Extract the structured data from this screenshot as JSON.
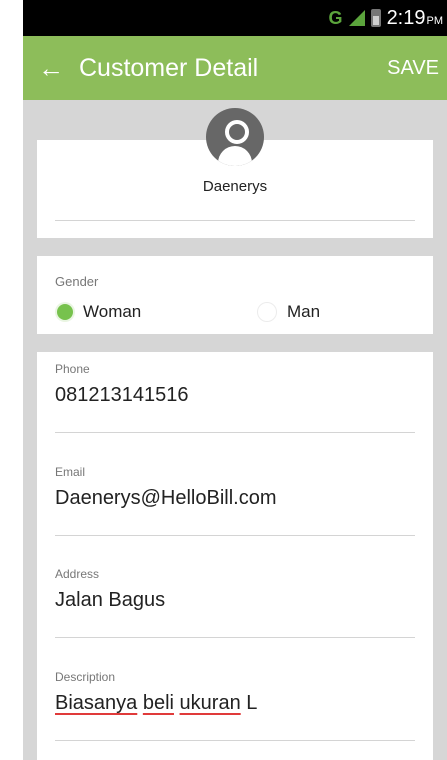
{
  "status_bar": {
    "network": "G",
    "time": "2:19",
    "ampm": "PM"
  },
  "app_bar": {
    "back_icon": "arrow-left-icon",
    "title": "Customer Detail",
    "save_label": "SAVE"
  },
  "profile": {
    "avatar_icon": "person-icon",
    "name": "Daenerys"
  },
  "gender": {
    "label": "Gender",
    "options": [
      {
        "label": "Woman",
        "selected": true
      },
      {
        "label": "Man",
        "selected": false
      }
    ]
  },
  "fields": {
    "phone": {
      "label": "Phone",
      "value": "081213141516"
    },
    "email": {
      "label": "Email",
      "value": "Daenerys@HelloBill.com"
    },
    "address": {
      "label": "Address",
      "value": "Jalan Bagus"
    },
    "description": {
      "label": "Description",
      "words": [
        "Biasanya",
        "beli",
        "ukuran",
        "L"
      ]
    }
  },
  "colors": {
    "app_bar": "#8dbd5a",
    "radio_selected": "#77c24d",
    "background": "#d6d6d6",
    "spell_underline": "#e03a3a"
  }
}
